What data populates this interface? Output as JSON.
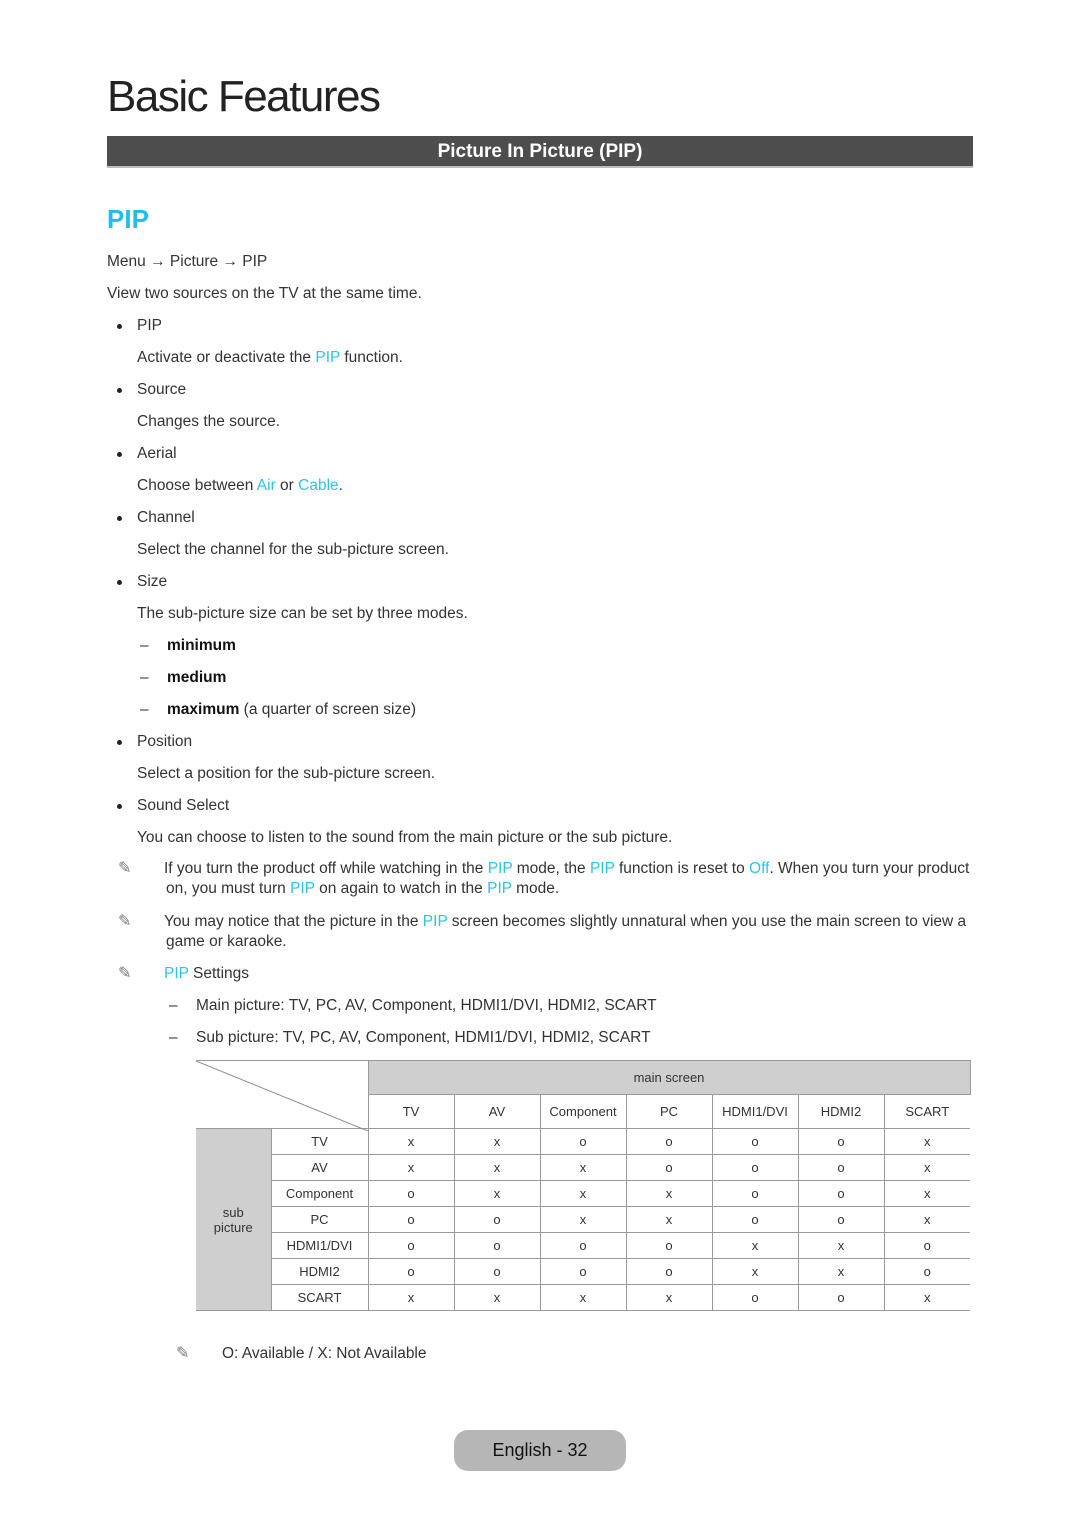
{
  "page": {
    "title": "Basic Features",
    "section_bar": "Picture In Picture (PIP)",
    "heading": "PIP",
    "breadcrumb": [
      "Menu",
      "Picture",
      "PIP"
    ],
    "breadcrumb_arrow": "→",
    "intro": "View two sources on the TV at the same time."
  },
  "items": [
    {
      "label": "PIP",
      "desc_pre": "Activate or deactivate the ",
      "desc_hl": "PIP",
      "desc_post": " function."
    },
    {
      "label": "Source",
      "desc": "Changes the source."
    },
    {
      "label": "Aerial",
      "desc_pre": "Choose between ",
      "desc_hl1": "Air",
      "desc_mid": " or ",
      "desc_hl2": "Cable",
      "desc_post": "."
    },
    {
      "label": "Channel",
      "desc": "Select the channel for the sub-picture screen."
    },
    {
      "label": "Size",
      "desc": "The sub-picture size can be set by three modes.",
      "modes": [
        {
          "name": "minimum",
          "extra": ""
        },
        {
          "name": "medium",
          "extra": ""
        },
        {
          "name": "maximum",
          "extra": " (a quarter of screen size)"
        }
      ]
    },
    {
      "label": "Position",
      "desc": "Select a position for the sub-picture screen."
    },
    {
      "label": "Sound Select",
      "desc": "You can choose to listen to the sound from the main picture or the sub picture."
    }
  ],
  "notes": {
    "note1": {
      "a": "If you turn the product off while watching in the ",
      "b": "PIP",
      "c": " mode, the ",
      "d": "PIP",
      "e": " function is reset to ",
      "f": "Off",
      "g": ". When you turn your product on, you must turn ",
      "h": "PIP",
      "i": " on again to watch in the ",
      "j": "PIP",
      "k": " mode."
    },
    "note2": {
      "a": "You may notice that the picture in the ",
      "b": "PIP",
      "c": " screen becomes slightly unnatural when you use the main screen to view a game or karaoke."
    },
    "note3": {
      "hl": "PIP",
      "text": " Settings"
    },
    "main_picture": "Main picture: TV, PC, AV, Component, HDMI1/DVI, HDMI2, SCART",
    "sub_picture": "Sub picture: TV, PC, AV, Component, HDMI1/DVI, HDMI2, SCART",
    "legend": "O: Available / X: Not Available",
    "note_icon": "✎",
    "dash": "–"
  },
  "table": {
    "main_header": "main screen",
    "sub_header": "sub picture",
    "columns": [
      "TV",
      "AV",
      "Component",
      "PC",
      "HDMI1/DVI",
      "HDMI2",
      "SCART"
    ],
    "rows": [
      {
        "name": "TV",
        "values": [
          "x",
          "x",
          "o",
          "o",
          "o",
          "o",
          "x"
        ]
      },
      {
        "name": "AV",
        "values": [
          "x",
          "x",
          "x",
          "o",
          "o",
          "o",
          "x"
        ]
      },
      {
        "name": "Component",
        "values": [
          "o",
          "x",
          "x",
          "x",
          "o",
          "o",
          "x"
        ]
      },
      {
        "name": "PC",
        "values": [
          "o",
          "o",
          "x",
          "x",
          "o",
          "o",
          "x"
        ]
      },
      {
        "name": "HDMI1/DVI",
        "values": [
          "o",
          "o",
          "o",
          "o",
          "x",
          "x",
          "o"
        ]
      },
      {
        "name": "HDMI2",
        "values": [
          "o",
          "o",
          "o",
          "o",
          "x",
          "x",
          "o"
        ]
      },
      {
        "name": "SCART",
        "values": [
          "x",
          "x",
          "x",
          "x",
          "o",
          "o",
          "x"
        ]
      }
    ]
  },
  "footer": {
    "label": "English - 32"
  },
  "colors": {
    "accent": "#2ac3ee",
    "section_bar": "#4d4d4d",
    "table_header": "#cfcfcf",
    "footer_pill": "#b6b6b6"
  }
}
